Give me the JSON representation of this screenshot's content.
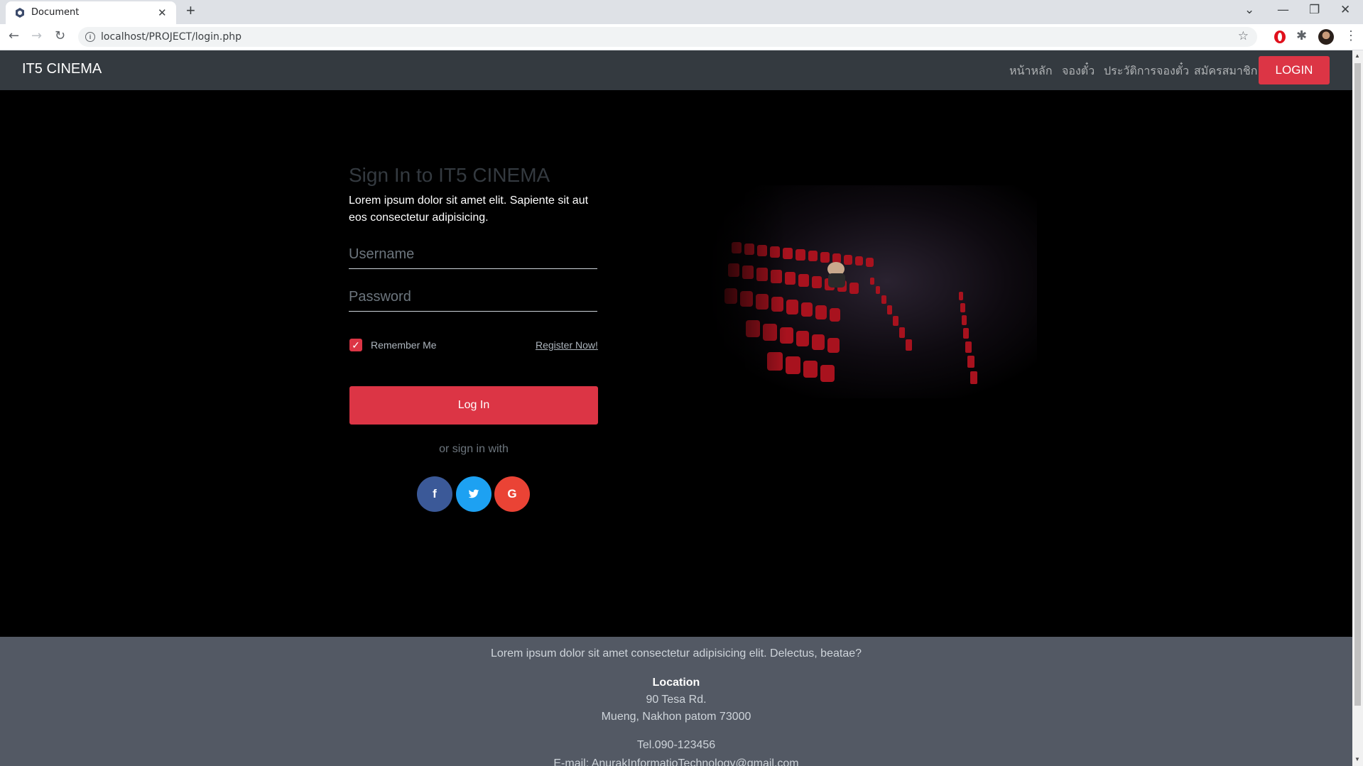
{
  "browser": {
    "tab_title": "Document",
    "url": "localhost/PROJECT/login.php"
  },
  "navbar": {
    "brand": "IT5 CINEMA",
    "links": [
      "หน้าหลัก",
      "จองตั๋ว",
      "ประวัติการจองตั๋ว",
      "สมัครสมาชิก"
    ],
    "login_label": "LOGIN"
  },
  "signin": {
    "title": "Sign In to IT5 CINEMA",
    "description": "Lorem ipsum dolor sit amet elit. Sapiente sit aut eos consectetur adipisicing.",
    "username_placeholder": "Username",
    "password_placeholder": "Password",
    "remember_label": "Remember Me",
    "remember_checked": true,
    "register_link": "Register Now!",
    "login_button": "Log In",
    "or_text": "or sign in with",
    "social": [
      {
        "name": "facebook",
        "glyph": "f",
        "color": "#3b5998"
      },
      {
        "name": "twitter",
        "glyph": "t",
        "color": "#1da1f2"
      },
      {
        "name": "google",
        "glyph": "G",
        "color": "#ea4335"
      }
    ]
  },
  "footer": {
    "tagline": "Lorem ipsum dolor sit amet consectetur adipisicing elit. Delectus, beatae?",
    "location_heading": "Location",
    "address_line1": "90 Tesa Rd.",
    "address_line2": "Mueng, Nakhon patom 73000",
    "tel": "Tel.090-123456",
    "email": "E-mail: AnurakInformatioTechnology@gmail.com"
  },
  "colors": {
    "accent": "#dc3545",
    "navbar": "#343a40",
    "footer": "#535964"
  }
}
